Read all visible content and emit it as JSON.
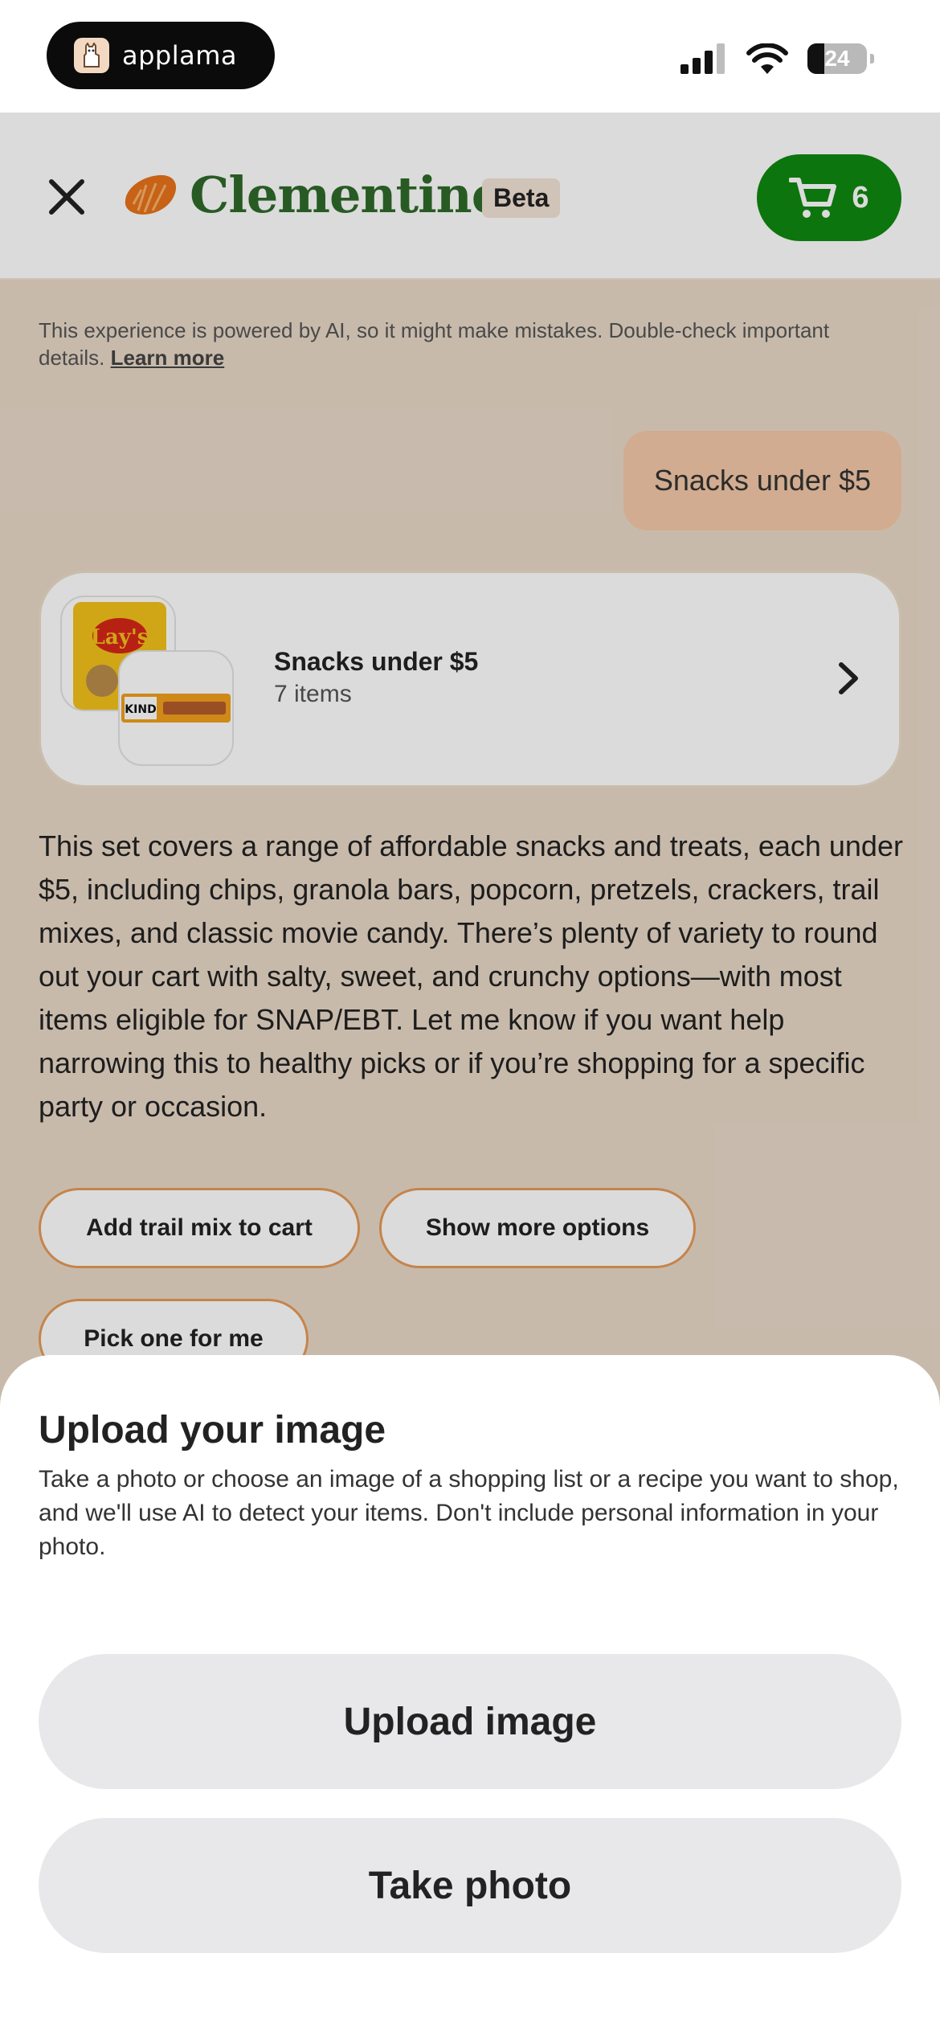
{
  "status_bar": {
    "app_pill": "applama",
    "battery": "24"
  },
  "header": {
    "brand": "Clementine",
    "badge": "Beta",
    "cart_count": "6"
  },
  "disclaimer": {
    "text": "This experience is powered by AI, so it might make mistakes. Double-check important details. ",
    "link": "Learn more"
  },
  "chat": {
    "user_message": "Snacks under $5",
    "list_card": {
      "title": "Snacks under $5",
      "subtitle": "7 items",
      "thumb1_brand": "Lay's",
      "thumb2_brand": "KIND"
    },
    "ai_message": "This set covers a range of affordable snacks and treats, each under $5, including chips, granola bars, popcorn, pretzels, crackers, trail mixes, and classic movie candy. There’s plenty of variety to round out your cart with salty, sweet, and crunchy options—with most items eligible for SNAP/EBT. Let me know if you want help narrowing this to healthy picks or if you’re shopping for a specific party or occasion.",
    "suggestions": [
      "Add trail mix to cart",
      "Show more options",
      "Pick one for me"
    ]
  },
  "sheet": {
    "title": "Upload your image",
    "description": "Take a photo or choose an image of a shopping list or a recipe you want to shop, and we'll use AI to detect your items. Don't include personal information in your photo.",
    "upload_button": "Upload image",
    "photo_button": "Take photo"
  },
  "colors": {
    "brand_green": "#2f6b2a",
    "cart_green": "#108910",
    "accent_orange": "#e69a58",
    "bubble_peach": "#f4c9a8"
  },
  "icons": [
    "llama-icon",
    "signal-icon",
    "wifi-icon",
    "battery-icon",
    "close-icon",
    "clementine-logo-icon",
    "cart-icon",
    "chevron-right-icon"
  ]
}
